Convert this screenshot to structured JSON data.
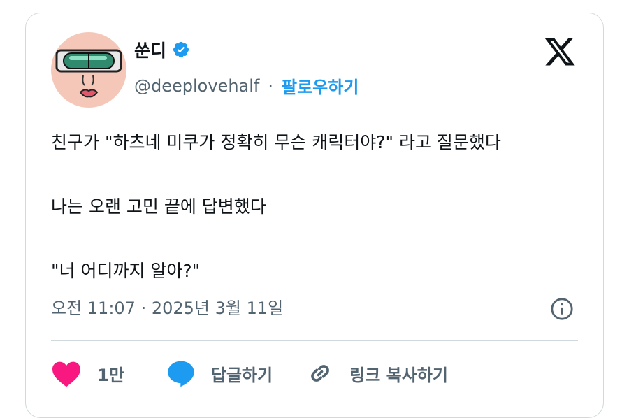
{
  "author": {
    "name": "쑨디",
    "handle": "@deeplovehalf",
    "separator": "·",
    "follow_label": "팔로우하기"
  },
  "tweet": {
    "paragraphs": [
      "친구가 \"하츠네 미쿠가 정확히 무슨 캐릭터야?\" 라고 질문했다",
      "나는 오랜 고민 끝에 답변했다",
      "\"너 어디까지 알아?\""
    ],
    "timestamp": "오전 11:07 · 2025년 3월 11일"
  },
  "actions": {
    "like_count": "1만",
    "reply_label": "답글하기",
    "copy_link_label": "링크 복사하기"
  },
  "colors": {
    "like": "#f91880",
    "reply": "#1d9bf0",
    "verified": "#1d9bf0",
    "text_secondary": "#536471",
    "border": "#cfd9de"
  },
  "icons": {
    "logo": "x-logo-icon",
    "verified": "verified-badge-icon",
    "info": "info-icon",
    "like": "heart-icon",
    "reply": "speech-bubble-icon",
    "copy": "link-icon"
  }
}
